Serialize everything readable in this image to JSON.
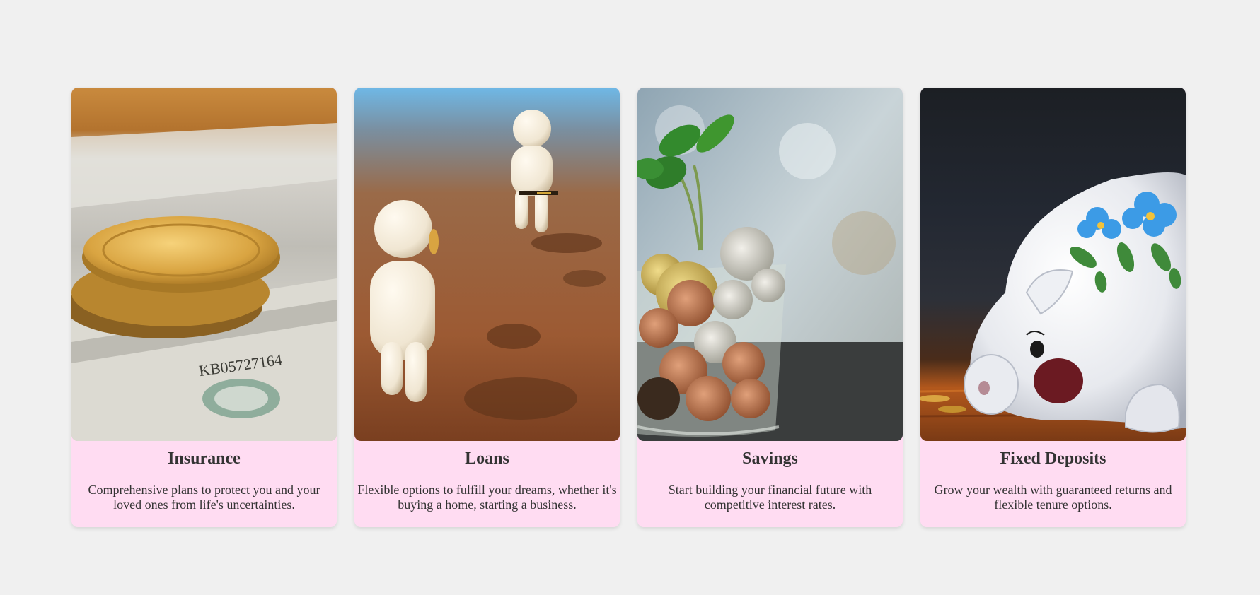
{
  "cards": [
    {
      "title": "Insurance",
      "description": "Comprehensive plans to protect you and your loved ones from life's uncertainties.",
      "image": "gold-coins-on-dollar-bills"
    },
    {
      "title": "Loans",
      "description": "Flexible options to fulfill your dreams, whether it's buying a home, starting a business.",
      "image": "two-figurines-passing-coin"
    },
    {
      "title": "Savings",
      "description": "Start building your financial future with competitive interest rates.",
      "image": "plant-growing-from-coin-jar"
    },
    {
      "title": "Fixed Deposits",
      "description": "Grow your wealth with guaranteed returns and flexible tenure options.",
      "image": "piggy-bank"
    }
  ],
  "colors": {
    "page_background": "#f0f0f0",
    "card_background": "#ffdcf2",
    "text": "#333333"
  }
}
